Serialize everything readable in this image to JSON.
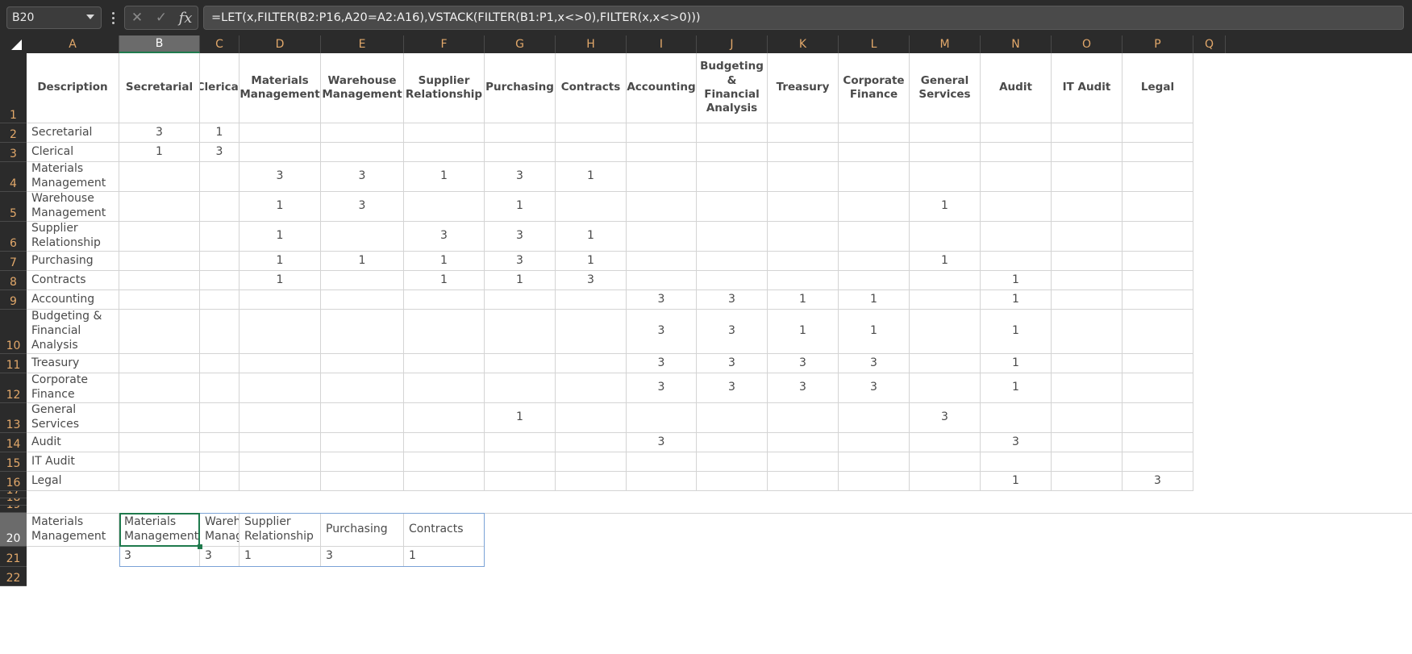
{
  "app": {
    "name_box_value": "B20",
    "formula": "=LET(x,FILTER(B2:P16,A20=A2:A16),VSTACK(FILTER(B1:P1,x<>0),FILTER(x,x<>0)))",
    "cancel_icon": "close-icon",
    "confirm_icon": "check-icon",
    "function_icon": "fx",
    "dropdown_icon": "chevron-down-icon",
    "menu_icon": "kebab-menu-icon"
  },
  "grid": {
    "column_letters": [
      "A",
      "B",
      "C",
      "D",
      "E",
      "F",
      "G",
      "H",
      "I",
      "J",
      "K",
      "L",
      "M",
      "N",
      "O",
      "P",
      "Q"
    ],
    "active_column": "B",
    "active_row": 20,
    "row_numbers": [
      1,
      2,
      3,
      4,
      5,
      6,
      7,
      8,
      9,
      10,
      11,
      12,
      13,
      14,
      15,
      16,
      17,
      18,
      19,
      20,
      21,
      22
    ]
  },
  "matrix": {
    "headers": [
      "Description",
      "Secretarial",
      "Clerical",
      "Materials Management",
      "Warehouse Management",
      "Supplier Relationship",
      "Purchasing",
      "Contracts",
      "Accounting",
      "Budgeting & Financial Analysis",
      "Treasury",
      "Corporate Finance",
      "General Services",
      "Audit",
      "IT Audit",
      "Legal"
    ],
    "rows": [
      {
        "row": 2,
        "label": "Secretarial",
        "values": [
          "3",
          "1",
          "",
          "",
          "",
          "",
          "",
          "",
          "",
          "",
          "",
          "",
          "",
          "",
          ""
        ]
      },
      {
        "row": 3,
        "label": "Clerical",
        "values": [
          "1",
          "3",
          "",
          "",
          "",
          "",
          "",
          "",
          "",
          "",
          "",
          "",
          "",
          "",
          ""
        ]
      },
      {
        "row": 4,
        "label": "Materials Management",
        "values": [
          "",
          "",
          "3",
          "3",
          "1",
          "3",
          "1",
          "",
          "",
          "",
          "",
          "",
          "",
          "",
          ""
        ]
      },
      {
        "row": 5,
        "label": "Warehouse Management",
        "values": [
          "",
          "",
          "1",
          "3",
          "",
          "1",
          "",
          "",
          "",
          "",
          "",
          "1",
          "",
          "",
          ""
        ]
      },
      {
        "row": 6,
        "label": "Supplier Relationship",
        "values": [
          "",
          "",
          "1",
          "",
          "3",
          "3",
          "1",
          "",
          "",
          "",
          "",
          "",
          "",
          "",
          ""
        ]
      },
      {
        "row": 7,
        "label": "Purchasing",
        "values": [
          "",
          "",
          "1",
          "1",
          "1",
          "3",
          "1",
          "",
          "",
          "",
          "",
          "1",
          "",
          "",
          ""
        ]
      },
      {
        "row": 8,
        "label": "Contracts",
        "values": [
          "",
          "",
          "1",
          "",
          "1",
          "1",
          "3",
          "",
          "",
          "",
          "",
          "",
          "1",
          "",
          ""
        ]
      },
      {
        "row": 9,
        "label": "Accounting",
        "values": [
          "",
          "",
          "",
          "",
          "",
          "",
          "",
          "3",
          "3",
          "1",
          "1",
          "",
          "1",
          "",
          ""
        ]
      },
      {
        "row": 10,
        "label": "Budgeting & Financial Analysis",
        "values": [
          "",
          "",
          "",
          "",
          "",
          "",
          "",
          "3",
          "3",
          "1",
          "1",
          "",
          "1",
          "",
          ""
        ]
      },
      {
        "row": 11,
        "label": "Treasury",
        "values": [
          "",
          "",
          "",
          "",
          "",
          "",
          "",
          "3",
          "3",
          "3",
          "3",
          "",
          "1",
          "",
          ""
        ]
      },
      {
        "row": 12,
        "label": "Corporate Finance",
        "values": [
          "",
          "",
          "",
          "",
          "",
          "",
          "",
          "3",
          "3",
          "3",
          "3",
          "",
          "1",
          "",
          ""
        ]
      },
      {
        "row": 13,
        "label": "General Services",
        "values": [
          "",
          "",
          "",
          "",
          "",
          "1",
          "",
          "",
          "",
          "",
          "",
          "3",
          "",
          "",
          ""
        ]
      },
      {
        "row": 14,
        "label": "Audit",
        "values": [
          "",
          "",
          "",
          "",
          "",
          "",
          "",
          "3",
          "",
          "",
          "",
          "",
          "3",
          "",
          ""
        ]
      },
      {
        "row": 15,
        "label": "IT Audit",
        "values": [
          "",
          "",
          "",
          "",
          "",
          "",
          "",
          "",
          "",
          "",
          "",
          "",
          "",
          "",
          ""
        ]
      },
      {
        "row": 16,
        "label": "Legal",
        "values": [
          "",
          "",
          "",
          "",
          "",
          "",
          "",
          "",
          "",
          "",
          "",
          "",
          "1",
          "",
          "3"
        ]
      }
    ]
  },
  "spill": {
    "input_label": "Materials Management",
    "header_row": [
      "Materials Management",
      "Warehouse Management",
      "Supplier Relationship",
      "Purchasing",
      "Contracts"
    ],
    "value_row": [
      "3",
      "3",
      "1",
      "3",
      "1"
    ]
  },
  "colors": {
    "header_bar": "#2b2b2b",
    "header_text": "#e2a86a",
    "active_header": "#6b6b6b",
    "active_cell_accent": "#1f7a4d",
    "spill_border": "#7aa2d6",
    "grid_line": "#d4d4d4",
    "cell_text": "#4a4a4a"
  }
}
